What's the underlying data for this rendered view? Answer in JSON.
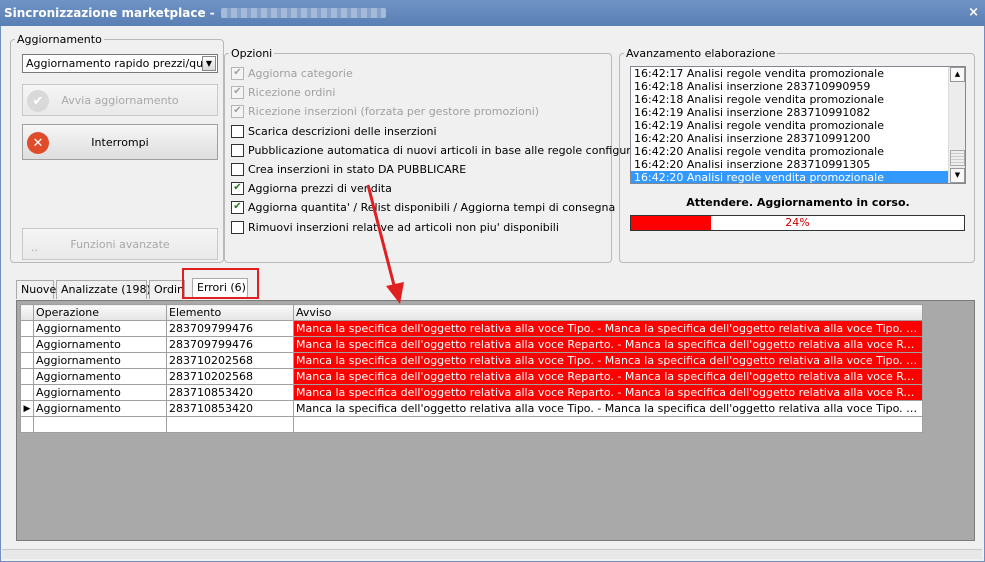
{
  "window": {
    "title": "Sincronizzazione marketplace -",
    "close_label": "×"
  },
  "aggiornamento": {
    "legend": "Aggiornamento",
    "mode_value": "Aggiornamento rapido prezzi/quantità",
    "start_button": "Avvia aggiornamento",
    "stop_button": "Interrompi",
    "advanced_button": "Funzioni avanzate",
    "advanced_prefix": ".."
  },
  "opzioni": {
    "legend": "Opzioni",
    "items": [
      {
        "label": "Aggiorna categorie",
        "checked": true,
        "enabled": false
      },
      {
        "label": "Ricezione ordini",
        "checked": true,
        "enabled": false
      },
      {
        "label": "Ricezione inserzioni (forzata per gestore promozioni)",
        "checked": true,
        "enabled": false
      },
      {
        "label": "Scarica descrizioni delle inserzioni",
        "checked": false,
        "enabled": true
      },
      {
        "label": "Pubblicazione automatica di nuovi articoli in base alle regole configurate",
        "checked": false,
        "enabled": true
      },
      {
        "label": "Crea inserzioni in stato DA PUBBLICARE",
        "checked": false,
        "enabled": true
      },
      {
        "label": "Aggiorna prezzi di vendita",
        "checked": true,
        "enabled": true
      },
      {
        "label": "Aggiorna quantita' / Relist disponibili / Aggiorna tempi di consegna",
        "checked": true,
        "enabled": true
      },
      {
        "label": "Rimuovi inserzioni relative ad articoli non piu' disponibili",
        "checked": false,
        "enabled": true
      }
    ]
  },
  "avanzamento": {
    "legend": "Avanzamento elaborazione",
    "log": [
      "16:42:17 Analisi regole vendita promozionale",
      "16:42:18 Analisi inserzione 283710990959",
      "16:42:18 Analisi regole vendita promozionale",
      "16:42:19 Analisi inserzione 283710991082",
      "16:42:19 Analisi regole vendita promozionale",
      "16:42:20 Analisi inserzione 283710991200",
      "16:42:20 Analisi regole vendita promozionale",
      "16:42:20 Analisi inserzione 283710991305",
      "16:42:20 Analisi regole vendita promozionale"
    ],
    "status": "Attendere. Aggiornamento in corso.",
    "progress": 0.24,
    "progress_label": "24%"
  },
  "tabs": [
    "Nuove",
    "Analizzate (198)",
    "Ordini",
    "Errori (6)"
  ],
  "grid": {
    "columns": [
      "Operazione",
      "Elemento",
      "Avviso"
    ],
    "rows": [
      {
        "op": "Aggiornamento",
        "el": "283709799476",
        "msg": "Manca la specifica dell'oggetto relativa alla voce Tipo. - Manca la specifica dell'oggetto relativa alla voce Tipo. - Manca la specific...",
        "error": true
      },
      {
        "op": "Aggiornamento",
        "el": "283709799476",
        "msg": "Manca la specifica dell'oggetto relativa alla voce Reparto. - Manca la specifica dell'oggetto relativa alla voce Reparto. - Manca la...",
        "error": true
      },
      {
        "op": "Aggiornamento",
        "el": "283710202568",
        "msg": "Manca la specifica dell'oggetto relativa alla voce Tipo. - Manca la specifica dell'oggetto relativa alla voce Tipo. - Manca la specific...",
        "error": true
      },
      {
        "op": "Aggiornamento",
        "el": "283710202568",
        "msg": "Manca la specifica dell'oggetto relativa alla voce Reparto. - Manca la specifica dell'oggetto relativa alla voce Reparto. - Manca la...",
        "error": true
      },
      {
        "op": "Aggiornamento",
        "el": "283710853420",
        "msg": "Manca la specifica dell'oggetto relativa alla voce Reparto. - Manca la specifica dell'oggetto relativa alla voce Reparto. - Manca la...",
        "error": true
      },
      {
        "op": "Aggiornamento",
        "el": "283710853420",
        "msg": "Manca la specifica dell'oggetto relativa alla voce Tipo. - Manca la specifica dell'oggetto relativa alla voce Tipo. - Manca la specific...",
        "error": false
      }
    ]
  },
  "colors": {
    "error_bg": "#ff0000",
    "selection": "#3399ff",
    "annotation": "#e02020"
  }
}
